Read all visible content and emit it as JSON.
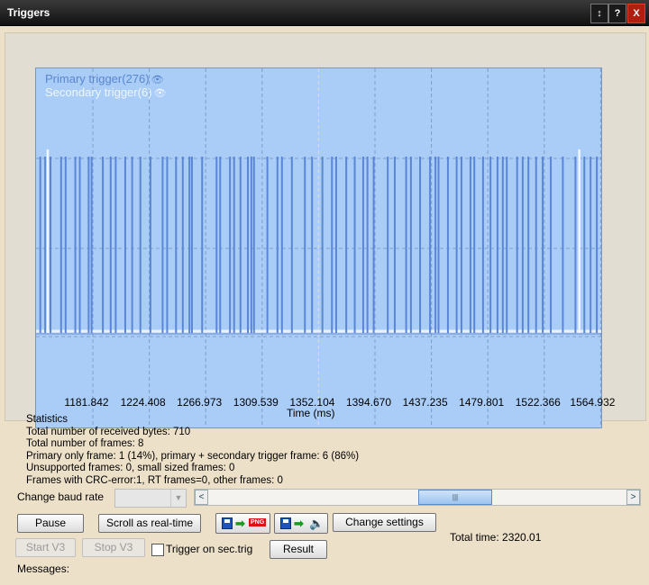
{
  "window": {
    "title": "Triggers",
    "buttons": [
      "↕",
      "?",
      "X"
    ]
  },
  "chart_data": {
    "type": "line",
    "title": "",
    "xlabel": "Time (ms)",
    "ylabel": "",
    "x_tick_labels": [
      "1181.842",
      "1224.408",
      "1266.973",
      "1309.539",
      "1352.104",
      "1394.670",
      "1437.235",
      "1479.801",
      "1522.366",
      "1564.932"
    ],
    "xlim": [
      1141,
      1564.932
    ],
    "grid": true,
    "series": [
      {
        "name": "Primary trigger(276)",
        "color": "#5b86d8",
        "pulses_ms": [
          1142.2,
          1145.9,
          1149.9,
          1157.9,
          1161.3,
          1168.6,
          1172.0,
          1178.7,
          1180.9,
          1189.4,
          1195.3,
          1199.1,
          1206.3,
          1211.5,
          1217.7,
          1225.3,
          1234.5,
          1237.9,
          1244.6,
          1249.7,
          1254.7,
          1256.6,
          1264.3,
          1275.2,
          1277.9,
          1285.3,
          1288.4,
          1293.2,
          1298.8,
          1301.4,
          1303.4,
          1313.5,
          1321.1,
          1324.5,
          1332.0,
          1341.8,
          1347.2,
          1355.0,
          1362.2,
          1365.4,
          1373.0,
          1379.4,
          1385.8,
          1389.0,
          1393.7,
          1404.3,
          1409.6,
          1418.2,
          1421.8,
          1428.7,
          1436.2,
          1440.3,
          1442.6,
          1449.7,
          1456.3,
          1459.9,
          1466.7,
          1469.6,
          1476.2,
          1481.8,
          1487.1,
          1491.1,
          1494.1,
          1501.9,
          1506.1,
          1510.4,
          1516.2,
          1521.2,
          1527.3,
          1536.4,
          1545.9,
          1552.6,
          1557.3,
          1562.0
        ]
      },
      {
        "name": "Secondary trigger(6)",
        "color": "#eef5ff",
        "pulses_ms": [
          1147.8,
          1548.8
        ]
      }
    ]
  },
  "legend": {
    "primary": "Primary trigger(276)",
    "secondary": "Secondary trigger(6)",
    "eye_icon": "👁"
  },
  "stats": {
    "heading": "Statistics",
    "line1": "Total number of received bytes: 710",
    "line2": "Total number of frames: 8",
    "line3": "Primary only frame: 1 (14%), primary + secondary trigger frame: 6 (86%)",
    "line4": "Unsupported frames: 0, small sized frames: 0",
    "line5": "Frames with CRC-error:1, RT frames=0, other frames: 0"
  },
  "controls": {
    "baud_label": "Change baud rate",
    "baud_value": "",
    "scroll_left": "<",
    "scroll_right": ">",
    "scroll_thumb": "|||",
    "scroll_position": 0.5,
    "pause": "Pause",
    "scroll_realtime": "Scroll as real-time",
    "png_label": "PNG",
    "change_settings": "Change settings",
    "total_time": "Total time: 2320.01",
    "start_v3": "Start V3",
    "stop_v3": "Stop V3",
    "trigger_sec": "Trigger on sec.trig",
    "trigger_sec_checked": false,
    "result": "Result",
    "messages": "Messages:"
  }
}
